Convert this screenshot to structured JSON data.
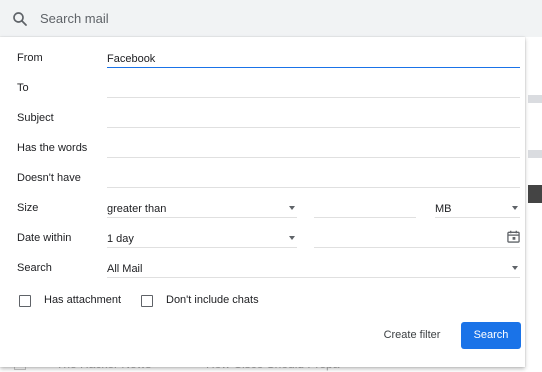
{
  "search": {
    "placeholder": "Search mail",
    "icon": "search-icon"
  },
  "background_row": {
    "sender": "The Hacker News",
    "subject": "How Cisco Should Prepa"
  },
  "filter": {
    "from": {
      "label": "From",
      "value": "Facebook"
    },
    "to": {
      "label": "To",
      "value": ""
    },
    "subject": {
      "label": "Subject",
      "value": ""
    },
    "has_words": {
      "label": "Has the words",
      "value": ""
    },
    "doesnt_have": {
      "label": "Doesn't have",
      "value": ""
    },
    "size": {
      "label": "Size",
      "operator": "greater than",
      "value": "",
      "unit": "MB"
    },
    "date_within": {
      "label": "Date within",
      "value": "1 day",
      "date": ""
    },
    "search_in": {
      "label": "Search",
      "value": "All Mail"
    },
    "has_attachment": {
      "label": "Has attachment",
      "checked": false
    },
    "dont_include_chats": {
      "label": "Don't include chats",
      "checked": false
    }
  },
  "actions": {
    "create_filter": "Create filter",
    "search": "Search"
  },
  "colors": {
    "accent": "#1a73e8",
    "topbar": "#f1f3f4"
  }
}
